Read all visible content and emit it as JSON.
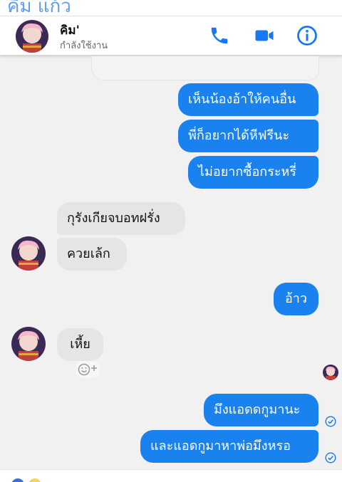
{
  "top_bar": {
    "text": "คิม แก้ว"
  },
  "header": {
    "name": "คิม'",
    "status": "กำลังใช้งาน",
    "icons": [
      "phone-icon",
      "video-icon",
      "info-icon"
    ],
    "accent": "#1877f2"
  },
  "messages": [
    {
      "from": "me",
      "text": "เห็นน้องอ้าให้คนอื่น"
    },
    {
      "from": "me",
      "text": "พี่ก็อยากได้หีฟรีนะ"
    },
    {
      "from": "me",
      "text": "ไม่อยากซื้อกระหรี่"
    },
    {
      "from": "them",
      "text": "กุรังเกียจบอทฝรั่ง"
    },
    {
      "from": "them",
      "text": "ควยเล้ก"
    },
    {
      "from": "me",
      "text": "อ้าว"
    },
    {
      "from": "them",
      "text": "เหี้ย"
    },
    {
      "from": "me",
      "text": "มึงแอดดกูมานะ"
    },
    {
      "from": "me",
      "text": "และแอดกูมาหาพ่อมึงหรอ"
    }
  ],
  "colors": {
    "outgoing_bubble": "#1a82ef",
    "incoming_bubble": "#e5e4e7",
    "background": "#f1f1f1"
  }
}
